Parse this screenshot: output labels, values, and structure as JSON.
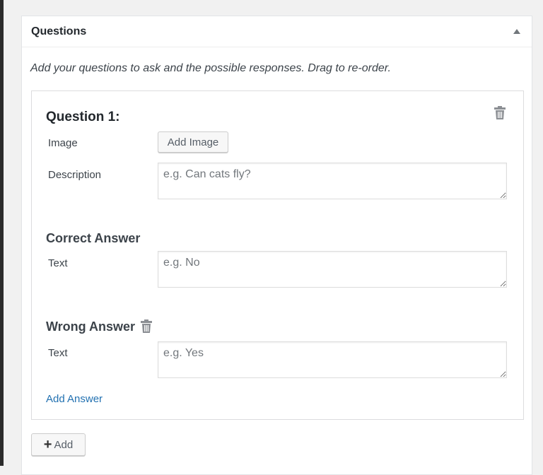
{
  "metabox": {
    "title": "Questions",
    "intro": "Add your questions to ask and the possible responses. Drag to re-order."
  },
  "question": {
    "title": "Question 1:",
    "image_label": "Image",
    "add_image_button": "Add Image",
    "description_label": "Description",
    "description_placeholder": "e.g. Can cats fly?",
    "description_value": "",
    "correct_heading": "Correct Answer",
    "correct_text_label": "Text",
    "correct_placeholder": "e.g. No",
    "wrong_heading": "Wrong Answer",
    "wrong_text_label": "Text",
    "wrong_placeholder": "e.g. Yes",
    "add_answer_link": "Add Answer"
  },
  "footer": {
    "add_button": "Add"
  },
  "colors": {
    "link": "#2271b1",
    "icon": "#72777c"
  }
}
